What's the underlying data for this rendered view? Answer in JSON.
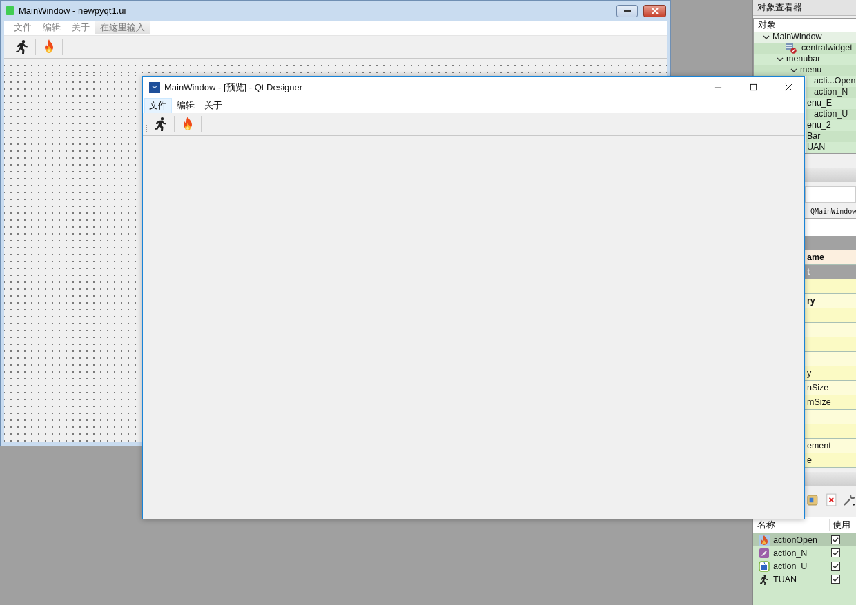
{
  "designer_window": {
    "title": "MainWindow - newpyqt1.ui",
    "menus": [
      {
        "label": "文件"
      },
      {
        "label": "编辑"
      },
      {
        "label": "关于"
      }
    ],
    "menu_placeholder": "在这里输入"
  },
  "preview_window": {
    "title": "MainWindow - [预览] - Qt Designer",
    "menus": [
      {
        "label": "文件",
        "selected": true
      },
      {
        "label": "编辑",
        "selected": false
      },
      {
        "label": "关于",
        "selected": false
      }
    ]
  },
  "object_inspector": {
    "title": "对象查看器",
    "column": "对象",
    "tree": [
      {
        "name": "MainWindow",
        "expanded": true,
        "children": [
          {
            "name": "centralwidget"
          },
          {
            "name": "menubar",
            "expanded": true,
            "children": [
              {
                "name": "menu",
                "expanded": true,
                "children": [
                  {
                    "name": "acti...Open"
                  },
                  {
                    "name": "action_N"
                  }
                ]
              },
              {
                "name": "enu_E",
                "children": [
                  {
                    "name": "action_U"
                  }
                ]
              },
              {
                "name": "enu_2"
              }
            ]
          },
          {
            "name": "Bar"
          },
          {
            "name": "UAN"
          }
        ]
      }
    ]
  },
  "property_editor": {
    "class_name": "QMainWindow",
    "rows": [
      {
        "kind": "section"
      },
      {
        "kind": "bold",
        "text": "ame"
      },
      {
        "kind": "section",
        "text": "t"
      },
      {
        "kind": "row"
      },
      {
        "kind": "bold",
        "text": "ry"
      },
      {
        "kind": "row"
      },
      {
        "kind": "row"
      },
      {
        "kind": "row"
      },
      {
        "kind": "row"
      },
      {
        "kind": "row",
        "text": "y"
      },
      {
        "kind": "row",
        "text": "nSize"
      },
      {
        "kind": "row",
        "text": "mSize"
      },
      {
        "kind": "row"
      },
      {
        "kind": "row"
      },
      {
        "kind": "row",
        "text": "ement"
      },
      {
        "kind": "row",
        "text": "e"
      }
    ]
  },
  "action_editor": {
    "columns": [
      "名称",
      "使用"
    ],
    "actions": [
      {
        "name": "actionOpen",
        "used": true,
        "selected": true
      },
      {
        "name": "action_N",
        "used": true,
        "selected": false
      },
      {
        "name": "action_U",
        "used": true,
        "selected": false
      },
      {
        "name": "TUAN",
        "used": true,
        "selected": false
      }
    ]
  }
}
